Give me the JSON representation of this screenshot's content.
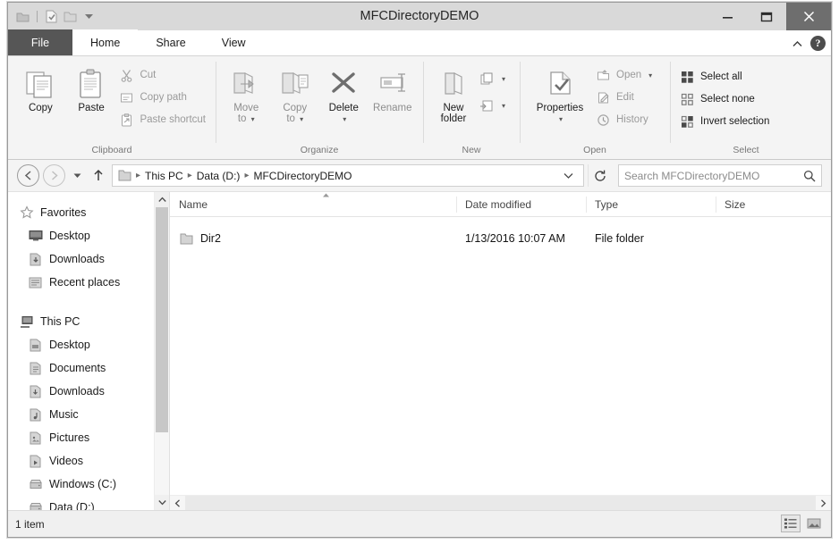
{
  "window": {
    "title": "MFCDirectoryDEMO",
    "quick_access": [
      "app-icon",
      "properties-icon",
      "new-folder-icon",
      "customize-caret"
    ],
    "controls": {
      "minimize": "—",
      "maximize": "☐",
      "close": "✕"
    }
  },
  "tabs": [
    {
      "id": "file",
      "label": "File",
      "active": false
    },
    {
      "id": "home",
      "label": "Home",
      "active": true
    },
    {
      "id": "share",
      "label": "Share",
      "active": false
    },
    {
      "id": "view",
      "label": "View",
      "active": false
    }
  ],
  "tab_right": {
    "collapse": "collapse-ribbon-icon",
    "help": "?"
  },
  "ribbon": {
    "groups": [
      {
        "name": "clipboard",
        "label": "Clipboard",
        "big": [
          {
            "label": "Copy",
            "icon": "copy-icon",
            "dim": false
          },
          {
            "label": "Paste",
            "icon": "paste-icon",
            "dim": false
          }
        ],
        "small": [
          {
            "label": "Cut",
            "icon": "cut-icon",
            "dim": true
          },
          {
            "label": "Copy path",
            "icon": "copy-path-icon",
            "dim": true
          },
          {
            "label": "Paste shortcut",
            "icon": "paste-shortcut-icon",
            "dim": true
          }
        ]
      },
      {
        "name": "organize",
        "label": "Organize",
        "big": [
          {
            "label": "Move\nto",
            "icon": "move-to-icon",
            "dim": true,
            "caret": true
          },
          {
            "label": "Copy\nto",
            "icon": "copy-to-icon",
            "dim": true,
            "caret": true
          },
          {
            "label": "Delete",
            "icon": "delete-icon",
            "dim": false,
            "caret": true
          },
          {
            "label": "Rename",
            "icon": "rename-icon",
            "dim": true,
            "caret": false
          }
        ],
        "small": []
      },
      {
        "name": "new",
        "label": "New",
        "big": [
          {
            "label": "New\nfolder",
            "icon": "new-folder-icon",
            "dim": false
          }
        ],
        "small": [
          {
            "label": "",
            "icon": "new-item-icon",
            "dim": true,
            "caret": true
          },
          {
            "label": "",
            "icon": "easy-access-icon",
            "dim": true,
            "caret": true
          }
        ]
      },
      {
        "name": "open",
        "label": "Open",
        "big": [
          {
            "label": "Properties",
            "icon": "properties-icon",
            "dim": false,
            "caret": true
          }
        ],
        "small": [
          {
            "label": "Open",
            "icon": "open-icon",
            "dim": true,
            "caret": true
          },
          {
            "label": "Edit",
            "icon": "edit-icon",
            "dim": true
          },
          {
            "label": "History",
            "icon": "history-icon",
            "dim": true
          }
        ]
      },
      {
        "name": "select",
        "label": "Select",
        "big": [],
        "small": [
          {
            "label": "Select all",
            "icon": "select-all-icon",
            "dim": false
          },
          {
            "label": "Select none",
            "icon": "select-none-icon",
            "dim": false
          },
          {
            "label": "Invert selection",
            "icon": "invert-selection-icon",
            "dim": false
          }
        ]
      }
    ]
  },
  "address": {
    "back": "←",
    "forward": "→",
    "recent_caret": "▾",
    "up": "↑",
    "breadcrumbs": [
      "This PC",
      "Data (D:)",
      "MFCDirectoryDEMO"
    ],
    "separator": "▸",
    "dropdown_caret": "⌄",
    "refresh": "↻",
    "search_placeholder": "Search MFCDirectoryDEMO",
    "search_value": "",
    "search_icon": "magnifier-icon"
  },
  "navpane": {
    "groups": [
      {
        "root": {
          "label": "Favorites",
          "icon": "star-icon"
        },
        "items": [
          {
            "label": "Desktop",
            "icon": "desktop-icon"
          },
          {
            "label": "Downloads",
            "icon": "downloads-icon"
          },
          {
            "label": "Recent places",
            "icon": "recent-places-icon"
          }
        ]
      },
      {
        "root": {
          "label": "This PC",
          "icon": "this-pc-icon"
        },
        "items": [
          {
            "label": "Desktop",
            "icon": "folder-desktop-icon"
          },
          {
            "label": "Documents",
            "icon": "folder-documents-icon"
          },
          {
            "label": "Downloads",
            "icon": "folder-downloads-icon"
          },
          {
            "label": "Music",
            "icon": "folder-music-icon"
          },
          {
            "label": "Pictures",
            "icon": "folder-pictures-icon"
          },
          {
            "label": "Videos",
            "icon": "folder-videos-icon"
          },
          {
            "label": "Windows (C:)",
            "icon": "drive-icon"
          },
          {
            "label": "Data (D:)",
            "icon": "drive-icon"
          }
        ]
      }
    ],
    "scroll": {
      "up": "⌃",
      "down": "⌄"
    }
  },
  "filelist": {
    "columns": [
      {
        "key": "name",
        "label": "Name",
        "sorted": "asc"
      },
      {
        "key": "date",
        "label": "Date modified",
        "sorted": ""
      },
      {
        "key": "type",
        "label": "Type",
        "sorted": ""
      },
      {
        "key": "size",
        "label": "Size",
        "sorted": ""
      }
    ],
    "rows": [
      {
        "name": "Dir2",
        "date": "1/13/2016 10:07 AM",
        "type": "File folder",
        "size": "",
        "icon": "folder-icon"
      }
    ],
    "hscroll": {
      "left": "‹",
      "right": "›"
    }
  },
  "statusbar": {
    "text": "1 item",
    "views": [
      {
        "name": "details-view-button",
        "selected": true
      },
      {
        "name": "large-icons-view-button",
        "selected": false
      }
    ]
  },
  "colors": {
    "titlebar": "#d9d9d9",
    "file_tab": "#565656",
    "ribbon": "#f4f4f4",
    "close_button": "#6e6e6e",
    "scroll_thumb": "#c7c7c7"
  }
}
